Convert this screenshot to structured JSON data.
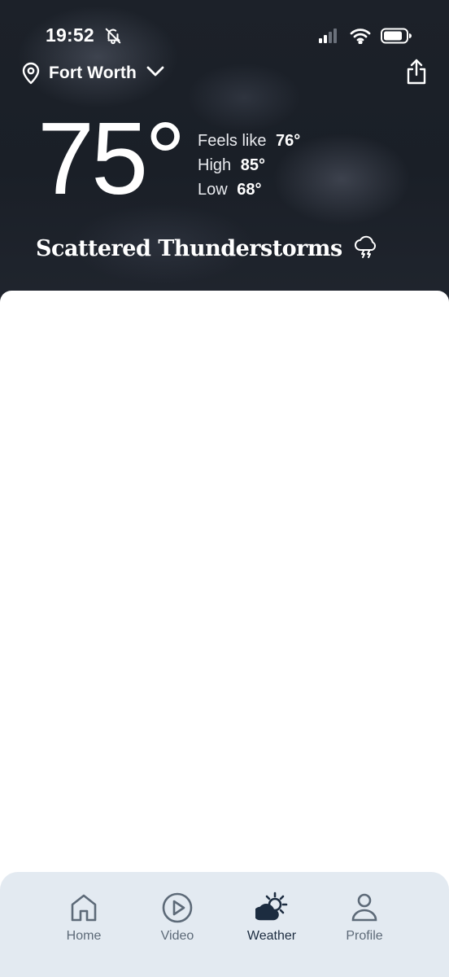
{
  "status_bar": {
    "time": "19:52",
    "icons": [
      "bell-slash-icon",
      "signal-icon",
      "wifi-icon",
      "battery-icon"
    ]
  },
  "location": {
    "name": "Fort Worth",
    "icon": "map-pin-icon",
    "dropdown_icon": "chevron-down-icon"
  },
  "share": {
    "icon": "share-icon"
  },
  "weather": {
    "temperature": "75°",
    "feels_like_label": "Feels like",
    "feels_like_value": "76°",
    "high_label": "High",
    "high_value": "85°",
    "low_label": "Low",
    "low_value": "68°",
    "condition": "Scattered Thunderstorms",
    "condition_icon": "thunderstorm-icon"
  },
  "tabs": [
    {
      "label": "Home",
      "icon": "home-icon",
      "active": false
    },
    {
      "label": "Video",
      "icon": "play-circle-icon",
      "active": false
    },
    {
      "label": "Weather",
      "icon": "sun-cloud-icon",
      "active": true
    },
    {
      "label": "Profile",
      "icon": "person-icon",
      "active": false
    }
  ],
  "colors": {
    "hero_background": "#1c2129",
    "tab_bar_background": "#e3eaf1",
    "tab_inactive": "#5d6a78",
    "tab_active": "#1c2c40"
  }
}
